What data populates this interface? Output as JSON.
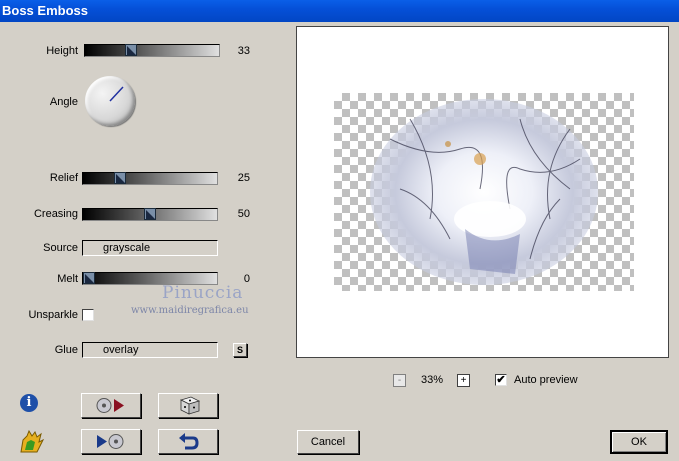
{
  "window": {
    "title": "Boss Emboss"
  },
  "controls": {
    "height": {
      "label": "Height",
      "value": "33",
      "level": 0.33
    },
    "angle": {
      "label": "Angle"
    },
    "relief": {
      "label": "Relief",
      "value": "25",
      "level": 0.25
    },
    "creasing": {
      "label": "Creasing",
      "value": "50",
      "level": 0.5
    },
    "source": {
      "label": "Source",
      "value": "grayscale"
    },
    "melt": {
      "label": "Melt",
      "value": "0",
      "level": 0
    },
    "unsparkle": {
      "label": "Unsparkle",
      "checked": false
    },
    "glue": {
      "label": "Glue",
      "value": "overlay",
      "button": "S"
    }
  },
  "watermark": {
    "line1": "Pinuccia",
    "line2": "www.maidiregrafica.eu"
  },
  "preview": {
    "zoom": "33%",
    "zoom_out": "-",
    "zoom_in": "+",
    "auto_preview_label": "Auto preview",
    "auto_preview_checked": true
  },
  "buttons": {
    "cancel": "Cancel",
    "ok": "OK"
  },
  "icons": {
    "info": "info-icon",
    "logo": "hand-logo-icon",
    "play_next": "disc-play-icon",
    "random": "dice-icon",
    "play_prev": "play-disc-icon",
    "undo": "undo-arrow-icon"
  }
}
